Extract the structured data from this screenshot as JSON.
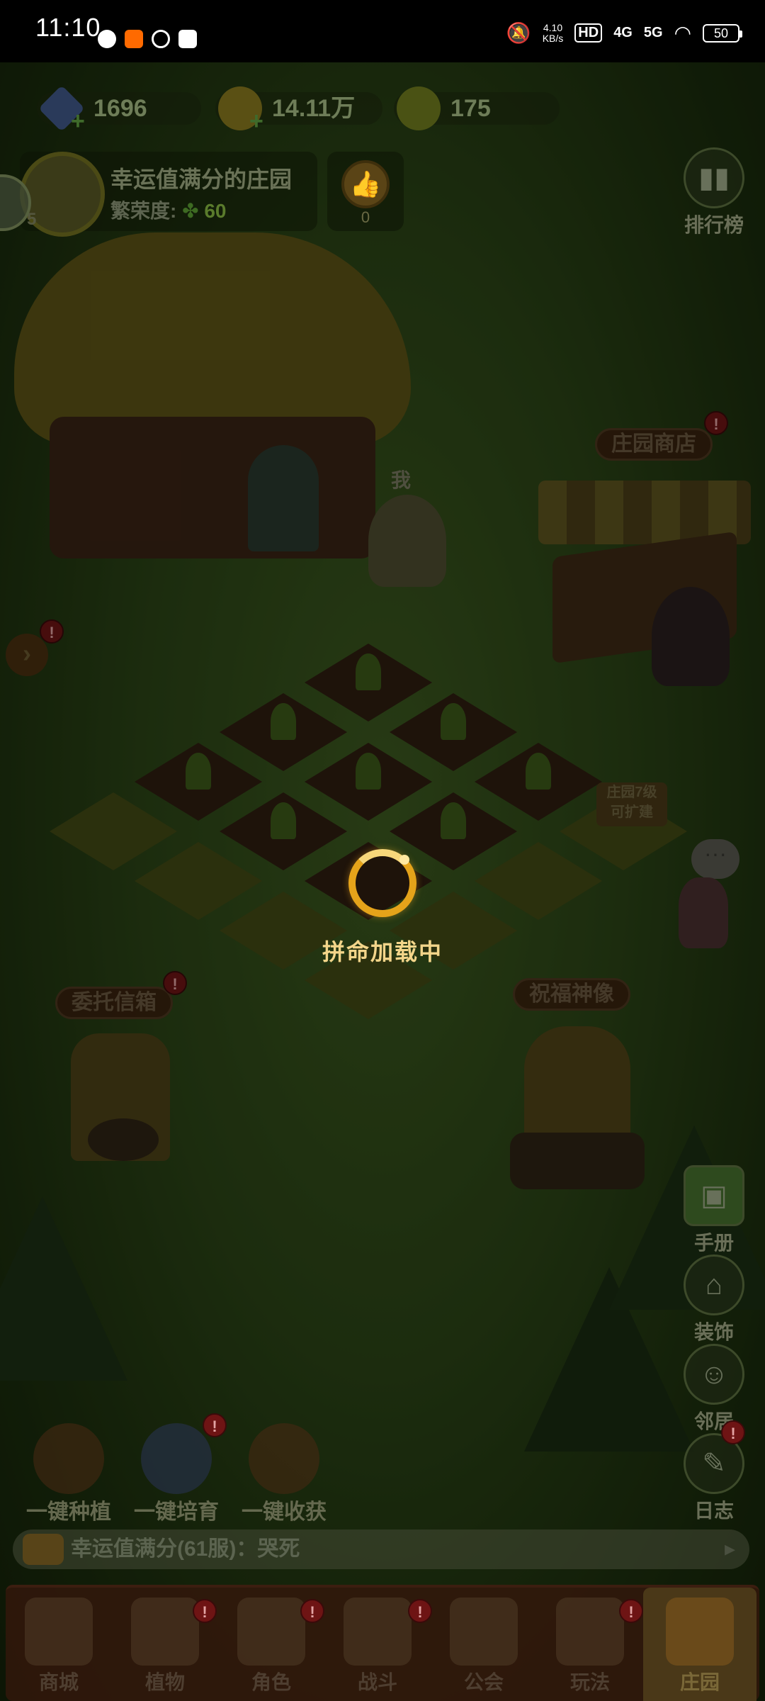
{
  "status_bar": {
    "time": "11:10",
    "net_speed_value": "4.10",
    "net_speed_unit": "KB/s",
    "hd": "HD",
    "sig1": "4G",
    "sig2": "5G",
    "battery": "50"
  },
  "currency": {
    "gems": "1696",
    "coins": "14.11万",
    "carrots": "175"
  },
  "profile": {
    "level": "5",
    "name": "幸运值满分的庄园",
    "prosperity_label": "繁荣度:",
    "prosperity_value": "60",
    "likes": "0"
  },
  "side": {
    "ranking": "排行榜",
    "handbook": "手册",
    "decorate": "装饰",
    "neighbor": "邻居",
    "log": "日志"
  },
  "scene_labels": {
    "shop": "庄园商店",
    "me": "我",
    "expand_line1": "庄园7级",
    "expand_line2": "可扩建",
    "mailbox": "委托信箱",
    "statue": "祝福神像"
  },
  "badge_mark": "!",
  "actions": {
    "plant_all": "一键种植",
    "nurture_all": "一键培育",
    "harvest_all": "一键收获"
  },
  "chat": "幸运值满分(61服)：哭死",
  "tabs": [
    "商城",
    "植物",
    "角色",
    "战斗",
    "公会",
    "玩法",
    "庄园"
  ],
  "loading": "拼命加载中"
}
